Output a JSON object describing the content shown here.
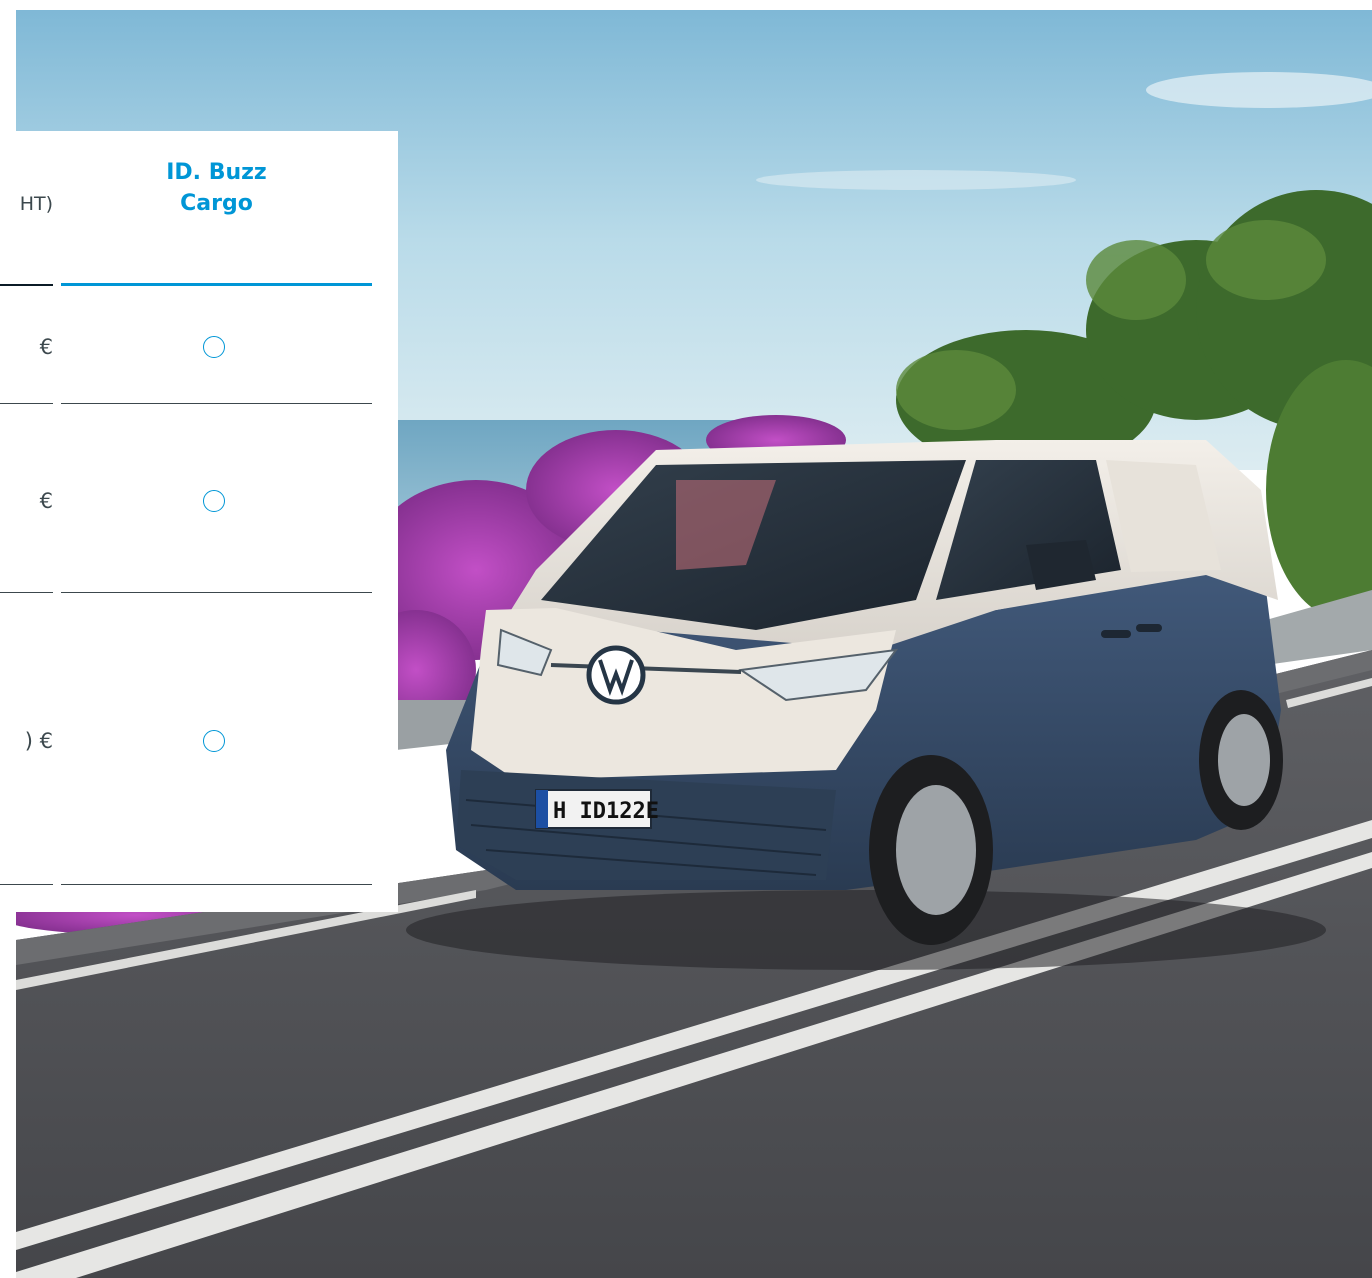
{
  "comparison": {
    "previous_column": {
      "header_fragment": "HT)",
      "rows": [
        {
          "price_fragment": "€"
        },
        {
          "price_fragment": "€"
        },
        {
          "price_fragment": ") €"
        }
      ]
    },
    "column": {
      "title_line1": "ID. Buzz",
      "title_line2": "Cargo",
      "options": [
        {
          "selected": false
        },
        {
          "selected": false
        },
        {
          "selected": false
        }
      ]
    }
  },
  "hero": {
    "license_plate": "H ID122E",
    "subject": "van-photo"
  },
  "colors": {
    "accent": "#0096d6",
    "text": "#3c484d",
    "rule_dark": "#0b1b26"
  }
}
